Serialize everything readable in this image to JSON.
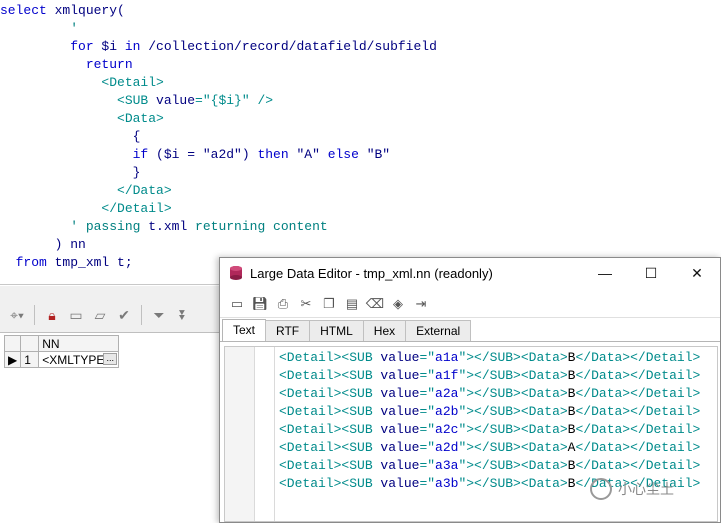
{
  "sql_editor": {
    "lines": [
      {
        "parts": [
          [
            "kw",
            "select "
          ],
          [
            "id",
            "xmlquery("
          ]
        ]
      },
      {
        "parts": [
          [
            "str",
            "         '"
          ]
        ]
      },
      {
        "parts": [
          [
            "kw",
            "         for "
          ],
          [
            "id",
            "$i "
          ],
          [
            "kw",
            "in "
          ],
          [
            "id",
            "/collection/record/datafield/subfield"
          ]
        ]
      },
      {
        "parts": [
          [
            "kw",
            "           return"
          ]
        ]
      },
      {
        "parts": [
          [
            "tag",
            "             <Detail>"
          ]
        ]
      },
      {
        "parts": [
          [
            "tag",
            "               <SUB "
          ],
          [
            "id",
            "value"
          ],
          [
            "tag",
            "=\"{$i}\" />"
          ]
        ]
      },
      {
        "parts": [
          [
            "tag",
            "               <Data>"
          ]
        ]
      },
      {
        "parts": [
          [
            "id",
            "                 {"
          ]
        ]
      },
      {
        "parts": [
          [
            "kw",
            "                 if "
          ],
          [
            "id",
            "($i = \"a2d\") "
          ],
          [
            "kw",
            "then "
          ],
          [
            "id",
            "\"A\" "
          ],
          [
            "kw",
            "else "
          ],
          [
            "id",
            "\"B\""
          ]
        ]
      },
      {
        "parts": [
          [
            "id",
            "                 }"
          ]
        ]
      },
      {
        "parts": [
          [
            "tag",
            "               </Data>"
          ]
        ]
      },
      {
        "parts": [
          [
            "tag",
            "             </Detail>"
          ]
        ]
      },
      {
        "parts": [
          [
            "str",
            "         ' passing "
          ],
          [
            "id",
            "t.xml "
          ],
          [
            "str",
            "returning content"
          ]
        ]
      },
      {
        "parts": [
          [
            "id",
            "       ) nn"
          ]
        ]
      },
      {
        "parts": [
          [
            "kw",
            "  from "
          ],
          [
            "id",
            "tmp_xml t;"
          ]
        ]
      }
    ]
  },
  "result_grid": {
    "column_header": "NN",
    "row_number": "1",
    "cell_value": "<XMLTYPE>",
    "ellipsis": "..."
  },
  "large_data_editor": {
    "title": "Large Data Editor - tmp_xml.nn (readonly)",
    "minimize": "—",
    "maximize": "☐",
    "close": "✕",
    "tabs": [
      "Text",
      "RTF",
      "HTML",
      "Hex",
      "External"
    ],
    "xml_rows": [
      {
        "value": "a1a",
        "data": "B"
      },
      {
        "value": "a1f",
        "data": "B"
      },
      {
        "value": "a2a",
        "data": "B"
      },
      {
        "value": "a2b",
        "data": "B"
      },
      {
        "value": "a2c",
        "data": "B"
      },
      {
        "value": "a2d",
        "data": "A"
      },
      {
        "value": "a3a",
        "data": "B"
      },
      {
        "value": "a3b",
        "data": "B"
      }
    ]
  },
  "watermark": {
    "text": "小心尘土"
  }
}
